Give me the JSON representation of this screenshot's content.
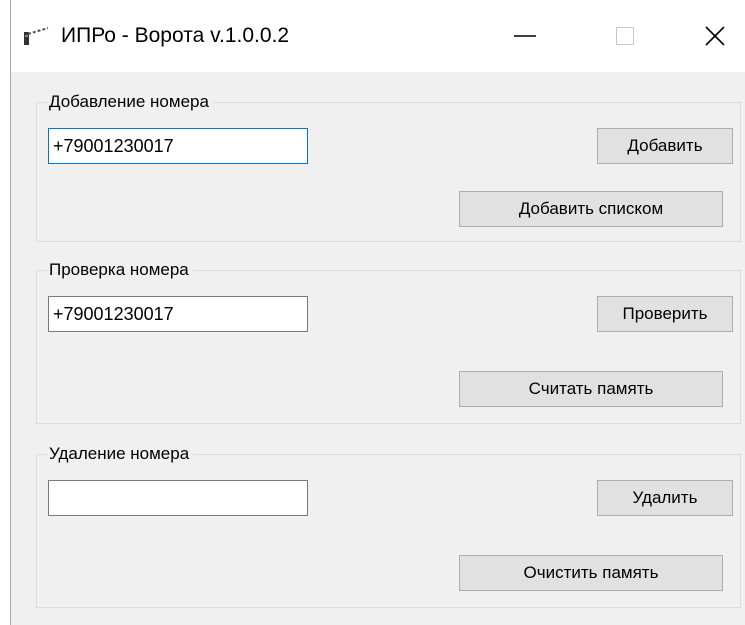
{
  "window": {
    "title": "ИПРо - Ворота v.1.0.0.2",
    "icon": "gate-barrier-icon",
    "controls": {
      "minimize": "—",
      "maximize": "☐",
      "close": "✕"
    }
  },
  "add_group": {
    "label": "Добавление номера",
    "phone_value": "+79001230017",
    "add_button": "Добавить",
    "add_list_button": "Добавить списком"
  },
  "check_group": {
    "label": "Проверка номера",
    "phone_value": "+79001230017",
    "check_button": "Проверить",
    "read_memory_button": "Считать память"
  },
  "delete_group": {
    "label": "Удаление номера",
    "phone_value": "",
    "delete_button": "Удалить",
    "clear_memory_button": "Очистить память"
  },
  "colors": {
    "window_bg": "#f0f0f0",
    "focus_border": "#0078d7",
    "button_bg": "#e1e1e1"
  }
}
